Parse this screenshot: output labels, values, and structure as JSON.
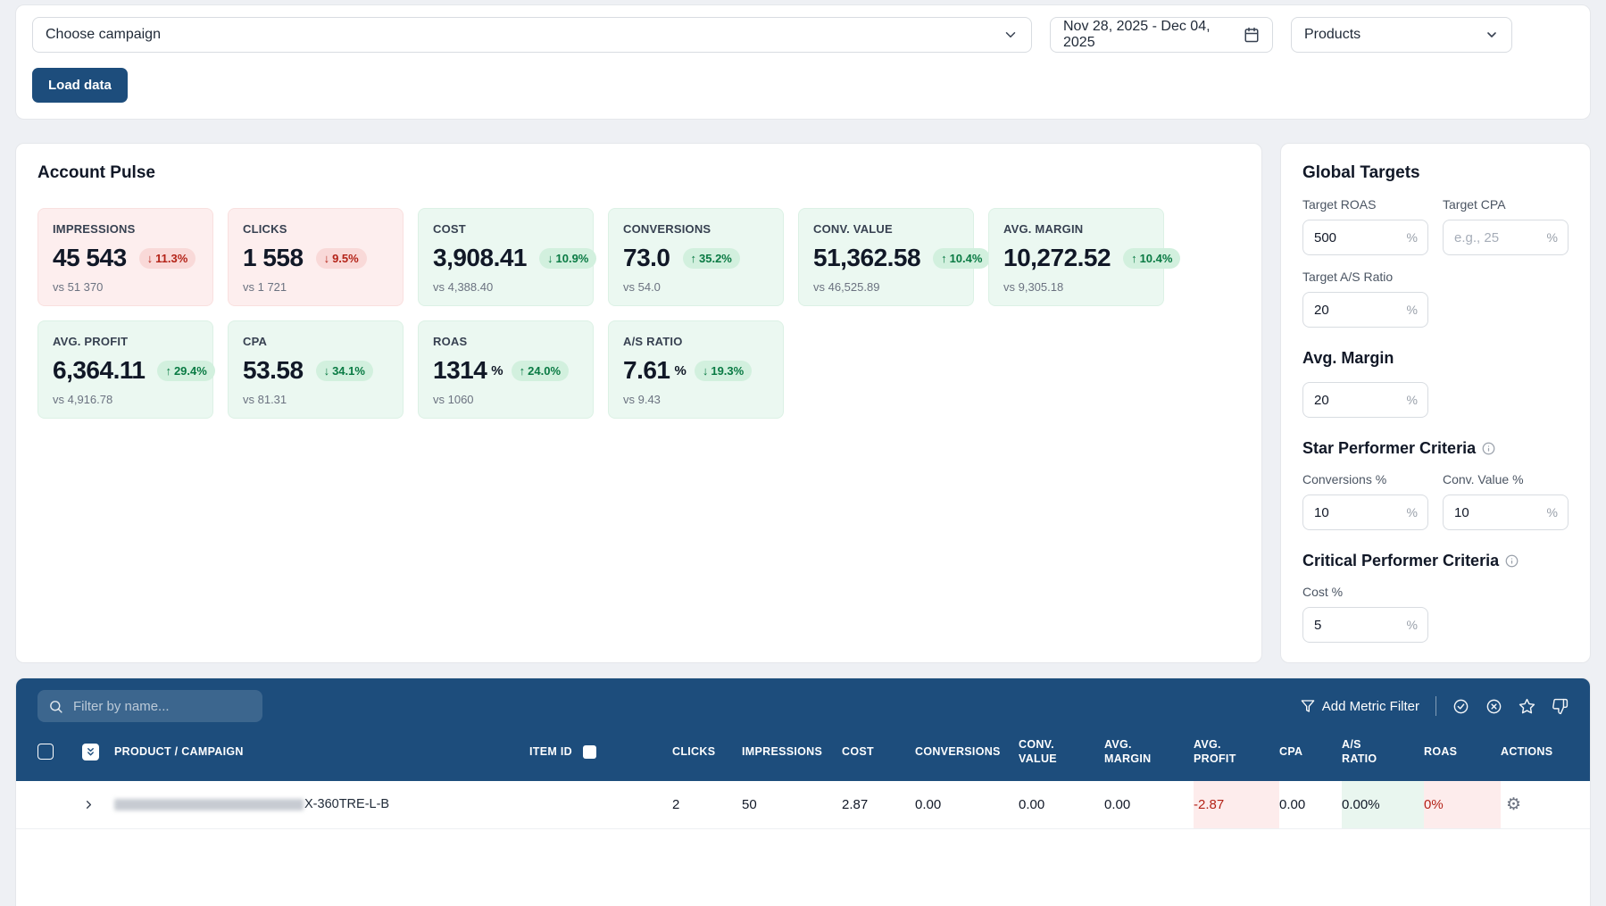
{
  "colors": {
    "header_blue": "#1d4d7c",
    "positive_green": "#097a43",
    "negative_red": "#b42318"
  },
  "toolbar": {
    "campaign_select": {
      "value": "Choose campaign"
    },
    "date_range": "Nov 28, 2025 - Dec 04, 2025",
    "view_select": "Products",
    "load_button": "Load data"
  },
  "account_pulse": {
    "title": "Account Pulse",
    "cards": [
      {
        "label": "IMPRESSIONS",
        "value": "45 543",
        "unit": "",
        "arrow": "↓",
        "delta": "11.3%",
        "vs": "vs 51 370"
      },
      {
        "label": "CLICKS",
        "value": "1 558",
        "unit": "",
        "arrow": "↓",
        "delta": "9.5%",
        "vs": "vs 1 721"
      },
      {
        "label": "COST",
        "value": "3,908.41",
        "unit": "",
        "arrow": "↓",
        "delta": "10.9%",
        "vs": "vs 4,388.40"
      },
      {
        "label": "CONVERSIONS",
        "value": "73.0",
        "unit": "",
        "arrow": "↑",
        "delta": "35.2%",
        "vs": "vs 54.0"
      },
      {
        "label": "CONV. VALUE",
        "value": "51,362.58",
        "unit": "",
        "arrow": "↑",
        "delta": "10.4%",
        "vs": "vs 46,525.89"
      },
      {
        "label": "AVG. MARGIN",
        "value": "10,272.52",
        "unit": "",
        "arrow": "↑",
        "delta": "10.4%",
        "vs": "vs 9,305.18"
      },
      {
        "label": "AVG. PROFIT",
        "value": "6,364.11",
        "unit": "",
        "arrow": "↑",
        "delta": "29.4%",
        "vs": "vs 4,916.78"
      },
      {
        "label": "CPA",
        "value": "53.58",
        "unit": "",
        "arrow": "↓",
        "delta": "34.1%",
        "vs": "vs 81.31"
      },
      {
        "label": "ROAS",
        "value": "1314",
        "unit": "%",
        "arrow": "↑",
        "delta": "24.0%",
        "vs": "vs 1060"
      },
      {
        "label": "A/S RATIO",
        "value": "7.61",
        "unit": "%",
        "arrow": "↓",
        "delta": "19.3%",
        "vs": "vs 9.43"
      }
    ]
  },
  "global_targets": {
    "title": "Global Targets",
    "target_roas": {
      "label": "Target ROAS",
      "value": "500",
      "suffix": "%"
    },
    "target_cpa": {
      "label": "Target CPA",
      "placeholder": "e.g., 25",
      "suffix": "%"
    },
    "target_as_ratio": {
      "label": "Target A/S Ratio",
      "value": "20",
      "suffix": "%"
    },
    "avg_margin": {
      "title": "Avg. Margin",
      "value": "20",
      "suffix": "%"
    },
    "star_criteria": {
      "title": "Star Performer Criteria",
      "conversions": {
        "label": "Conversions %",
        "value": "10",
        "suffix": "%"
      },
      "conv_value": {
        "label": "Conv. Value %",
        "value": "10",
        "suffix": "%"
      }
    },
    "critical_criteria": {
      "title": "Critical Performer Criteria",
      "cost": {
        "label": "Cost %",
        "value": "5",
        "suffix": "%"
      }
    }
  },
  "table": {
    "search_placeholder": "Filter by name...",
    "add_metric_filter": "Add Metric Filter",
    "columns": [
      "PRODUCT / CAMPAIGN",
      "ITEM ID",
      "CLICKS",
      "IMPRESSIONS",
      "COST",
      "CONVERSIONS",
      "CONV. VALUE",
      "AVG. MARGIN",
      "AVG. PROFIT",
      "CPA",
      "A/S RATIO",
      "ROAS",
      "ACTIONS"
    ],
    "rows": [
      {
        "name": "X-360TRE-L-B",
        "clicks": "2",
        "impressions": "50",
        "cost": "2.87",
        "conversions": "0.00",
        "conv_value": "0.00",
        "avg_margin": "0.00",
        "avg_profit": "-2.87",
        "cpa": "0.00",
        "as_ratio": "0.00%",
        "roas": "0%"
      }
    ]
  }
}
